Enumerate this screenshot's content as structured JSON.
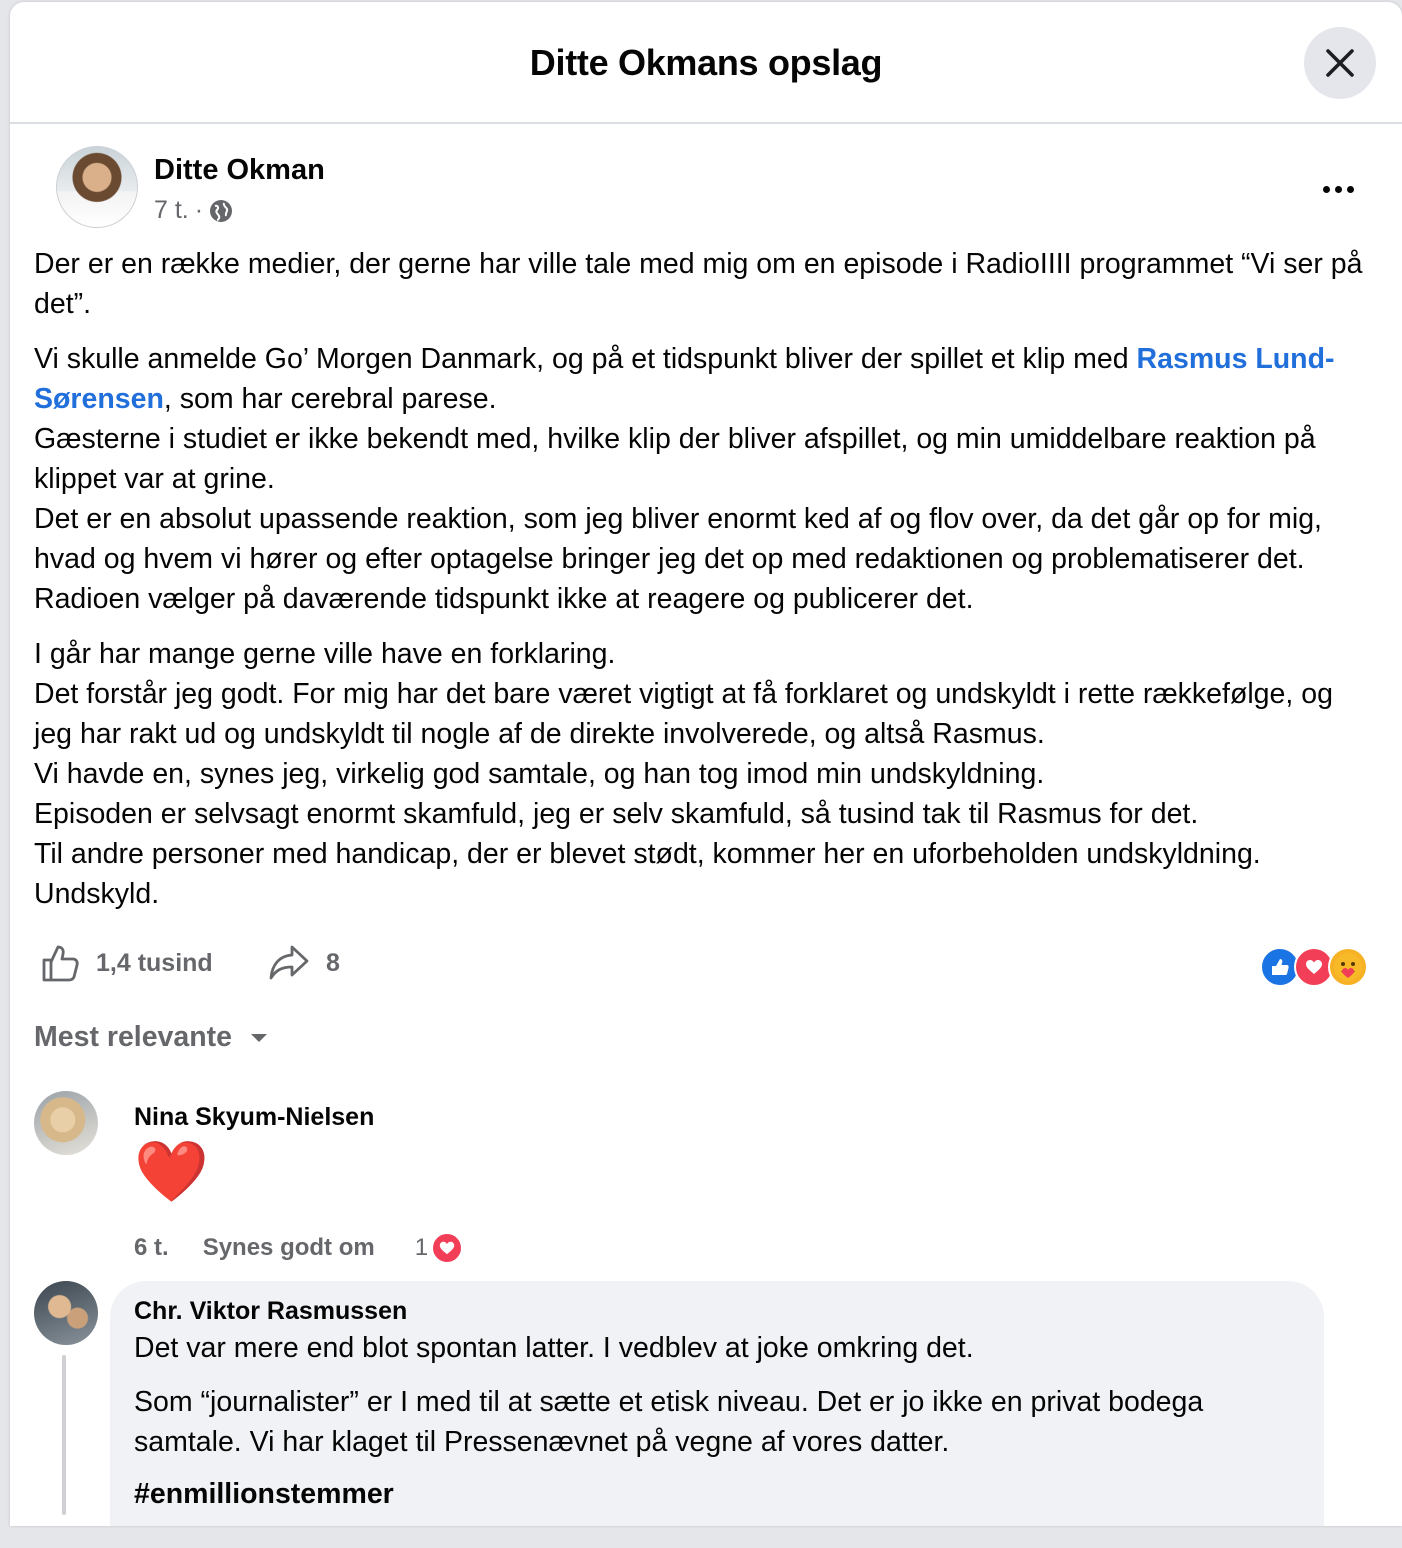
{
  "header": {
    "title": "Ditte Okmans opslag"
  },
  "post": {
    "author": "Ditte Okman",
    "time": "7 t.",
    "separator": "·",
    "paragraphs": {
      "p1": "Der er en række medier, der gerne har ville tale med mig om en episode i RadioIIII programmet “Vi ser på det”.",
      "p2_before": "Vi skulle anmelde Go’ Morgen Danmark, og på et tidspunkt bliver der spillet et klip med ",
      "p2_mention": "Rasmus Lund-Sørensen",
      "p2_after": ", som har cerebral parese.",
      "p2_line2": "Gæsterne i studiet er ikke bekendt med, hvilke klip der bliver afspillet, og min umiddelbare reaktion på klippet var at grine.",
      "p2_line3": "Det er en absolut upassende reaktion, som jeg bliver enormt ked af og flov over, da det går op for mig, hvad og hvem vi hører og efter optagelse bringer jeg det op med redaktionen og problematiserer det.",
      "p2_line4": "Radioen vælger på daværende tidspunkt ikke at reagere og publicerer det.",
      "p3_line1": "I går har mange gerne ville have en forklaring.",
      "p3_line2": "Det forstår jeg godt. For mig har det bare været vigtigt at få forklaret og undskyldt i rette rækkefølge, og jeg har rakt ud og undskyldt til nogle af de direkte involverede, og altså Rasmus.",
      "p3_line3": "Vi havde en, synes jeg, virkelig god samtale, og han tog imod min undskyldning.",
      "p3_line4": "Episoden er selvsagt enormt skamfuld, jeg er selv skamfuld, så tusind tak til Rasmus for det.",
      "p3_line5": "Til andre personer med handicap, der er blevet stødt, kommer her en uforbeholden undskyldning.",
      "p3_line6": "Undskyld."
    },
    "like_count": "1,4 tusind",
    "share_count": "8",
    "reactions": [
      "like-icon",
      "love-icon",
      "care-icon"
    ]
  },
  "sort": {
    "label": "Mest relevante"
  },
  "comments": [
    {
      "author": "Nina Skyum-Nielsen",
      "emoji": "❤️",
      "time": "6 t.",
      "like_label": "Synes godt om",
      "reaction_count": "1"
    },
    {
      "author": "Chr. Viktor Rasmussen",
      "line1": "Det var mere end blot spontan latter. I vedblev at joke omkring det.",
      "line2": "Som “journalister” er I med til at sætte et etisk niveau. Det er jo ikke en privat bodega samtale. Vi har klaget til Pressenævnet på vegne af vores datter.",
      "hashtag": "#enmillionstemmer"
    }
  ],
  "colors": {
    "link": "#216fdb",
    "secondary_text": "#65676b",
    "like_blue": "#1b74e4",
    "love_red": "#f33e58"
  }
}
